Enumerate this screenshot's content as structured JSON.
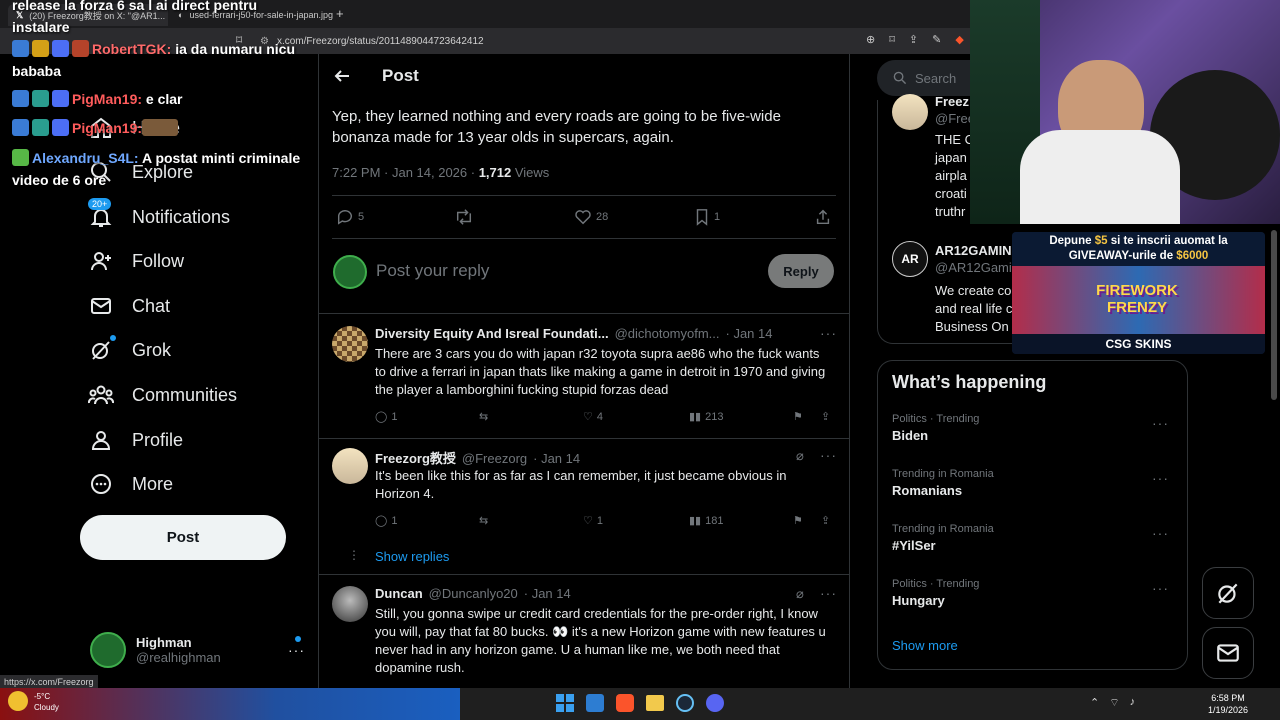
{
  "browser": {
    "tabs": [
      {
        "label": "(20) Freezorg教授 on X: \"@AR1...",
        "active": true
      },
      {
        "label": "used-ferrari-j50-for-sale-in-japan.jpg",
        "active": false
      }
    ],
    "url": "x.com/Freezorg/status/2011489044723642412",
    "status_url": "https://x.com/Freezorg"
  },
  "chat_overlay": [
    {
      "user": "",
      "text": "release la forza 6 sa l ai direct pentru instalare",
      "color": "#ffffff"
    },
    {
      "user": "RobertTGK:",
      "text": " ia da numaru nicu bababa",
      "color": "#ff6a6a"
    },
    {
      "user": "PigMan19:",
      "text": " e clar",
      "color": "#ff5c5c"
    },
    {
      "user": "PigMan19:",
      "text": "",
      "color": "#ff5c5c"
    },
    {
      "user": "Alexandru_S4L:",
      "text": " A postat minti criminale video de 6 ore",
      "color": "#6fa8ff"
    }
  ],
  "nav": {
    "items": [
      {
        "label": "Home",
        "icon": "home-icon"
      },
      {
        "label": "Explore",
        "icon": "search-icon"
      },
      {
        "label": "Notifications",
        "icon": "bell-icon",
        "badge": "20+"
      },
      {
        "label": "Follow",
        "icon": "add-person-icon"
      },
      {
        "label": "Chat",
        "icon": "mail-icon"
      },
      {
        "label": "Grok",
        "icon": "grok-icon"
      },
      {
        "label": "Communities",
        "icon": "communities-icon"
      },
      {
        "label": "Profile",
        "icon": "person-icon"
      },
      {
        "label": "More",
        "icon": "more-circle-icon"
      }
    ],
    "post_button": "Post",
    "account": {
      "name": "Highman",
      "handle": "@realhighman"
    }
  },
  "header": {
    "title": "Post"
  },
  "main_post": {
    "text": "Yep, they learned nothing and every roads are going to be five-wide bonanza made for 13 year olds in supercars, again.",
    "time": "7:22 PM · Jan 14, 2026 · ",
    "views": "1,712",
    "views_label": " Views",
    "replies": "5",
    "reposts": "",
    "likes": "28",
    "bookmarks": "1"
  },
  "composer": {
    "placeholder": "Post your reply",
    "button": "Reply"
  },
  "replies": [
    {
      "name": "Diversity Equity And Isreal Foundati...",
      "handle": "@dichotomyofm...",
      "date": "· Jan 14",
      "text": "There are 3 cars you do with japan r32 toyota supra ae86 who the fuck wants to drive a ferrari in japan thats like making a game in detroit in 1970 and giving the player a lamborghini fucking stupid forzas dead",
      "replies": "1",
      "likes": "4",
      "views": "213"
    },
    {
      "name": "Freezorg教授",
      "handle": "@Freezorg",
      "date": "· Jan 14",
      "text": "It's been like this for as far as I can remember, it just became obvious in Horizon 4.",
      "replies": "1",
      "likes": "1",
      "views": "181"
    },
    {
      "name": "Duncan",
      "handle": "@Duncanlyo20",
      "date": "· Jan 14",
      "text": "Still, you gonna swipe ur credit card credentials for the pre-order right, I know you will, pay that fat 80 bucks. 👀 it's a new Horizon game with new features u never had in any horizon game. U a human like me, we both need that dopamine rush."
    }
  ],
  "show_replies": "Show replies",
  "right": {
    "search_placeholder": "Search",
    "who": [
      {
        "name": "Freez",
        "handle": "@Free",
        "text": "THE C japan airpla croati truthr"
      },
      {
        "name": "AR12GAMIN",
        "handle": "@AR12Gami",
        "text": "We create co and real life c Business On"
      }
    ],
    "promo": {
      "line1_a": "Depune ",
      "line1_amount": "$5",
      "line1_b": " si te inscrii auomat la",
      "line2_a": "GIVEAWAY-urile de ",
      "line2_amount": "$6000",
      "game": "FIREWORK FRENZY",
      "brand": "CSG SKINS"
    },
    "happening": {
      "title": "What’s happening",
      "trends": [
        {
          "category": "Politics · Trending",
          "name": "Biden"
        },
        {
          "category": "Trending in Romania",
          "name": "Romanians"
        },
        {
          "category": "Trending in Romania",
          "name": "#YilSer"
        },
        {
          "category": "Politics · Trending",
          "name": "Hungary"
        }
      ],
      "show_more": "Show more"
    }
  },
  "taskbar": {
    "weather_temp": "-5°C",
    "weather_text": "Cloudy",
    "time": "6:58 PM",
    "date": "1/19/2026"
  },
  "colors": {
    "accent": "#1d9bf0",
    "promo_gold": "#f5c542"
  }
}
